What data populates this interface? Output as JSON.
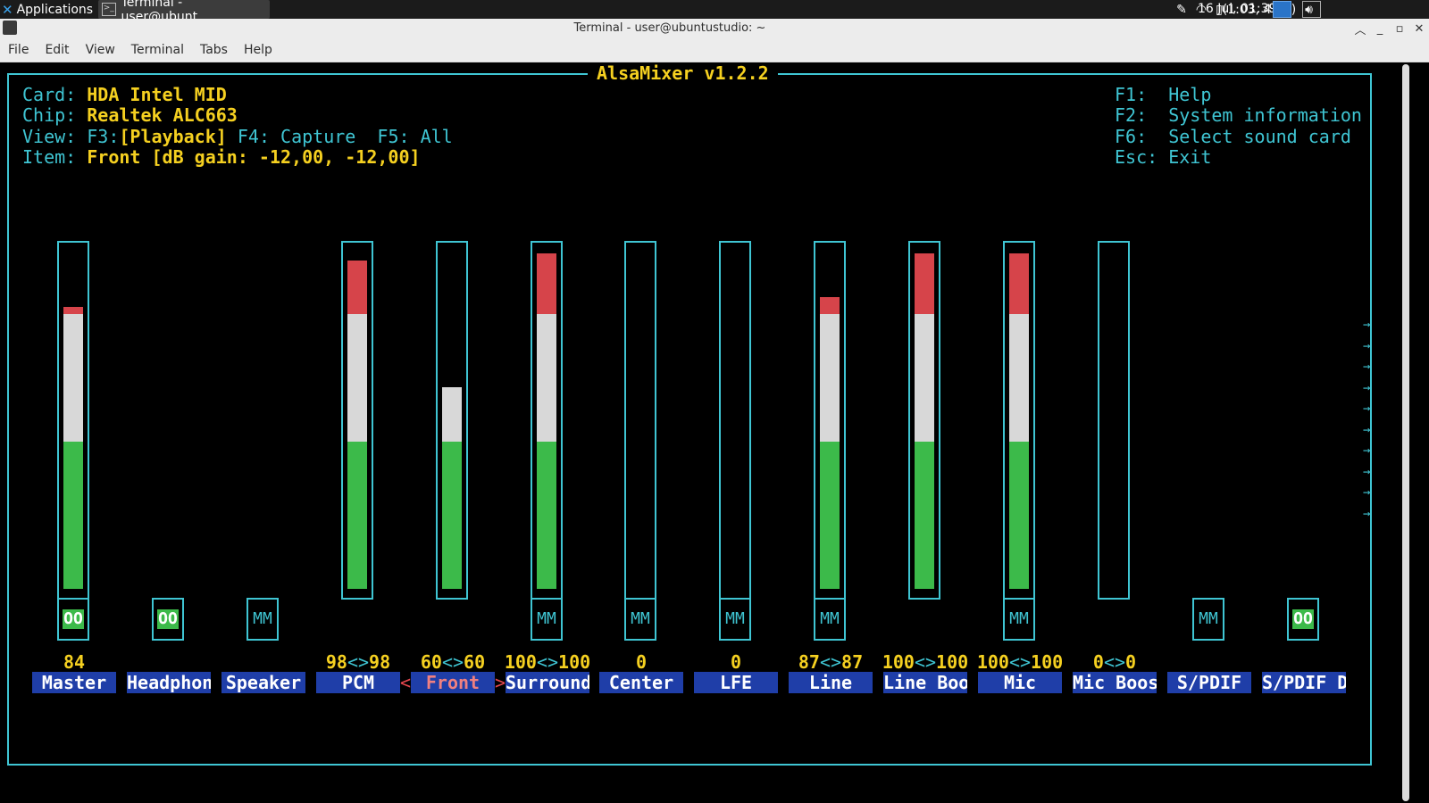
{
  "panel": {
    "applications_label": "Applications",
    "task_label": "Terminal - user@ubunt...",
    "battery": "(1:03, 47%)",
    "clock": "16 Jul, 01:39"
  },
  "window": {
    "title": "Terminal - user@ubuntustudio: ~"
  },
  "menu": [
    "File",
    "Edit",
    "View",
    "Terminal",
    "Tabs",
    "Help"
  ],
  "alsamixer": {
    "title": "AlsaMixer v1.2.2",
    "card_label": "Card:",
    "card": "HDA Intel MID",
    "chip_label": "Chip:",
    "chip": "Realtek ALC663",
    "view_label": "View:",
    "view_f3": "F3:",
    "view_playback": "[Playback]",
    "view_f4": "F4: Capture",
    "view_f5": "F5: All",
    "item_label": "Item:",
    "item": "Front [dB gain: -12,00, -12,00]",
    "help": [
      {
        "key": "F1:",
        "text": "Help"
      },
      {
        "key": "F2:",
        "text": "System information"
      },
      {
        "key": "F6:",
        "text": "Select sound card"
      },
      {
        "key": "Esc:",
        "text": "Exit"
      }
    ],
    "controls": [
      {
        "name": "Master",
        "value": "84",
        "level": 0.84,
        "bar": true,
        "switch": "OO",
        "selected": false
      },
      {
        "name": "Headphon",
        "value": "",
        "level": 0,
        "bar": false,
        "switch": "OO",
        "selected": false
      },
      {
        "name": "Speaker",
        "value": "",
        "level": 0,
        "bar": false,
        "switch": "MM",
        "selected": false
      },
      {
        "name": "PCM",
        "value": "98<>98",
        "level": 0.98,
        "bar": true,
        "switch": "",
        "selected": false
      },
      {
        "name": "Front",
        "value": "60<>60",
        "level": 0.6,
        "bar": true,
        "switch": "",
        "selected": true
      },
      {
        "name": "Surround",
        "value": "100<>100",
        "level": 1.0,
        "bar": true,
        "switch": "MM",
        "selected": false
      },
      {
        "name": "Center",
        "value": "0",
        "level": 0,
        "bar": true,
        "switch": "MM",
        "selected": false
      },
      {
        "name": "LFE",
        "value": "0",
        "level": 0,
        "bar": true,
        "switch": "MM",
        "selected": false
      },
      {
        "name": "Line",
        "value": "87<>87",
        "level": 0.87,
        "bar": true,
        "switch": "MM",
        "selected": false
      },
      {
        "name": "Line Boo",
        "value": "100<>100",
        "level": 1.0,
        "bar": true,
        "switch": "",
        "selected": false
      },
      {
        "name": "Mic",
        "value": "100<>100",
        "level": 1.0,
        "bar": true,
        "switch": "MM",
        "selected": false
      },
      {
        "name": "Mic Boos",
        "value": "0<>0",
        "level": 0,
        "bar": true,
        "switch": "",
        "selected": false
      },
      {
        "name": "S/PDIF",
        "value": "",
        "level": 0,
        "bar": false,
        "switch": "MM",
        "selected": false
      },
      {
        "name": "S/PDIF D",
        "value": "",
        "level": 0,
        "bar": false,
        "switch": "OO",
        "selected": false
      }
    ],
    "more_arrow": "→",
    "sel_left": "<",
    "sel_right": ">"
  },
  "colors": {
    "green": "#3cba4a",
    "white": "#d8d8d8",
    "red": "#d6444a",
    "cyan": "#3fc5d3",
    "yellow": "#f5d020",
    "label_bg": "#1f3ea8"
  }
}
